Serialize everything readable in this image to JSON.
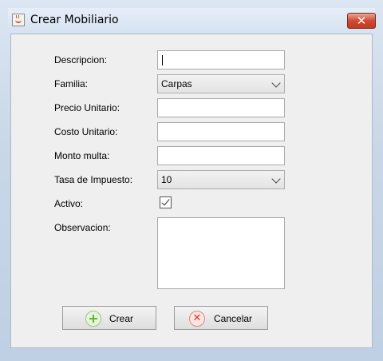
{
  "window": {
    "title": "Crear Mobiliario",
    "close_glyph": "✕",
    "app_icon": "java-cup-icon"
  },
  "form": {
    "descripcion": {
      "label": "Descripcion:",
      "value": ""
    },
    "familia": {
      "label": "Familia:",
      "selected": "Carpas"
    },
    "precio_unitario": {
      "label": "Precio Unitario:",
      "value": ""
    },
    "costo_unitario": {
      "label": "Costo Unitario:",
      "value": ""
    },
    "monto_multa": {
      "label": "Monto multa:",
      "value": ""
    },
    "tasa_impuesto": {
      "label": "Tasa de Impuesto:",
      "selected": "10"
    },
    "activo": {
      "label": "Activo:",
      "checked": true
    },
    "observacion": {
      "label": "Observacion:",
      "value": ""
    }
  },
  "buttons": {
    "crear": {
      "label": "Crear",
      "icon": "plus-icon"
    },
    "cancelar": {
      "label": "Cancelar",
      "icon": "cancel-icon"
    }
  },
  "colors": {
    "title_bar": "#d5e2f1",
    "close_button": "#cf4b32",
    "client_background": "#efefef",
    "plus_icon": "#5fb832",
    "cancel_icon": "#d9362a"
  }
}
